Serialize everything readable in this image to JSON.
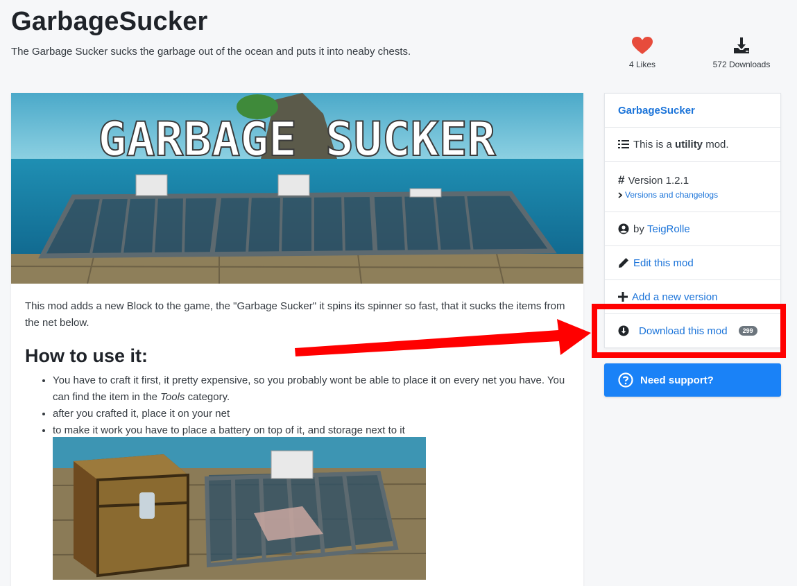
{
  "header": {
    "title": "GarbageSucker",
    "subtitle": "The Garbage Sucker sucks the garbage out of the ocean and puts it into neaby chests.",
    "likes": "4 Likes",
    "downloads": "572 Downloads"
  },
  "banner": {
    "text": "GARBAGE SUCKER"
  },
  "content": {
    "intro": "This mod adds a new Block to the game, the \"Garbage Sucker\" it spins its spinner so fast, that it sucks the items from the net below.",
    "how_heading": "How to use it:",
    "step1_a": "You have to craft it first, it pretty expensive, so you probably wont be able to place it on every net you have. You can find the item in the ",
    "step1_em": "Tools",
    "step1_b": " category.",
    "step2": "after you crafted it, place it on your net",
    "step3": "to make it work you have to place a battery on top of it, and storage next to it"
  },
  "sidebar": {
    "mod_name": "GarbageSucker",
    "type_prefix": "This is a ",
    "type_bold": "utility",
    "type_suffix": " mod.",
    "version": "Version 1.2.1",
    "versions_link": "Versions and changelogs",
    "by_prefix": "by ",
    "author": "TeigRolle",
    "edit": "Edit this mod",
    "add_version": "Add a new version",
    "download": "Download this mod",
    "download_count": "299",
    "support": "Need support?"
  },
  "colors": {
    "accent": "#1a73d9",
    "support_bg": "#1a82f7",
    "highlight": "#ff0000",
    "heart": "#e74c3c"
  }
}
